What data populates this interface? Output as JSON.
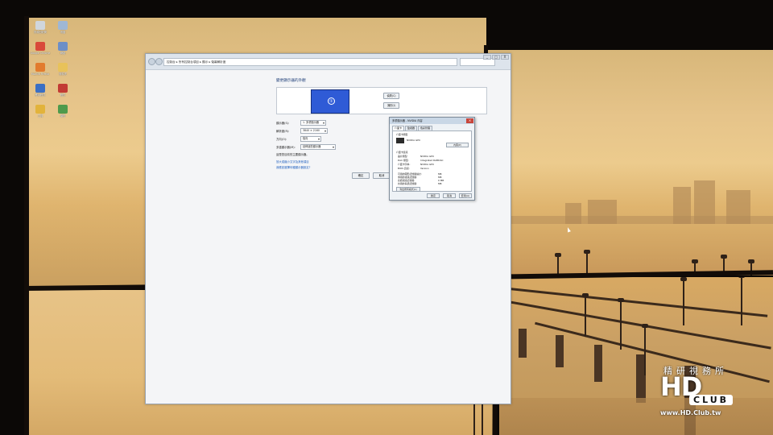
{
  "window": {
    "address": "控制台 ▸ 所有控制台項目 ▸ 顯示 ▸ 螢幕解析度",
    "controls": [
      "_",
      "□",
      "X"
    ],
    "section_title": "變更顯示器的外觀",
    "monitor_number": "①",
    "detect_label": "偵測(C)",
    "identify_label": "識別(I)",
    "rows": [
      {
        "label": "顯示器(S):",
        "value": "1. 多重顯示器"
      },
      {
        "label": "解析度(R):",
        "value": "3840 × 2160"
      },
      {
        "label": "方向(O):",
        "value": "橫向"
      },
      {
        "label": "多重顯示器(M):",
        "value": "延伸這些顯示器"
      }
    ],
    "main_display_note": "這是您目前的主要顯示器。",
    "links": [
      "放大或縮小文字及其他項目",
      "我應該選擇何種顯示器設定?"
    ],
    "ok_label": "確定",
    "cancel_label": "取消"
  },
  "dialog": {
    "title": "多重顯示器 - NVIDIA 內容",
    "tabs": [
      "介面卡",
      "監視器",
      "色彩管理"
    ],
    "adapter_type_label": "介面卡類型",
    "adapter_name": "NVIDIA GPU",
    "properties_label": "內容(P)",
    "info_title": "介面卡資訊",
    "info_rows": [
      {
        "k": "晶片類型:",
        "v": "NVIDIA GPU"
      },
      {
        "k": "DAC 類型:",
        "v": "Integrated RAMDAC"
      },
      {
        "k": "介面卡字串:",
        "v": "NVIDIA GPU"
      },
      {
        "k": "BIOS 資訊:",
        "v": "Version"
      }
    ],
    "mem_rows": [
      {
        "k": "可用的圖形記憶體總計:",
        "v": "MB"
      },
      {
        "k": "專用的視訊記憶體:",
        "v": "MB"
      },
      {
        "k": "系統視訊記憶體:",
        "v": "0 MB"
      },
      {
        "k": "共用的系統記憶體:",
        "v": "MB"
      }
    ],
    "list_modes_label": "列出所有模式(L)",
    "ok_label": "確定",
    "cancel_label": "取消",
    "apply_label": "套用(A)"
  },
  "desktop_icons": [
    {
      "name": "recycle-bin",
      "label": "資源回收筒",
      "color": "#d0d6dc"
    },
    {
      "name": "computer",
      "label": "電腦",
      "color": "#9fb7d4"
    },
    {
      "name": "chrome",
      "label": "Google Chrome",
      "color": "#d9493a"
    },
    {
      "name": "network",
      "label": "網路",
      "color": "#6d8fc7"
    },
    {
      "name": "firefox",
      "label": "Mozilla Firefox",
      "color": "#e27b2e"
    },
    {
      "name": "folder",
      "label": "資料夾",
      "color": "#e8c25a"
    },
    {
      "name": "app-blue",
      "label": "應用程式",
      "color": "#3b6fc4"
    },
    {
      "name": "app-red",
      "label": "程式",
      "color": "#c23b34"
    },
    {
      "name": "app-yellow",
      "label": "工具",
      "color": "#e2b33b"
    },
    {
      "name": "app-green",
      "label": "捷徑",
      "color": "#4e9a4c"
    }
  ],
  "watermark": {
    "brand_cn": "精研視務所",
    "logo": "HD",
    "club": "CLUB",
    "url": "www.HD.Club.tw"
  }
}
